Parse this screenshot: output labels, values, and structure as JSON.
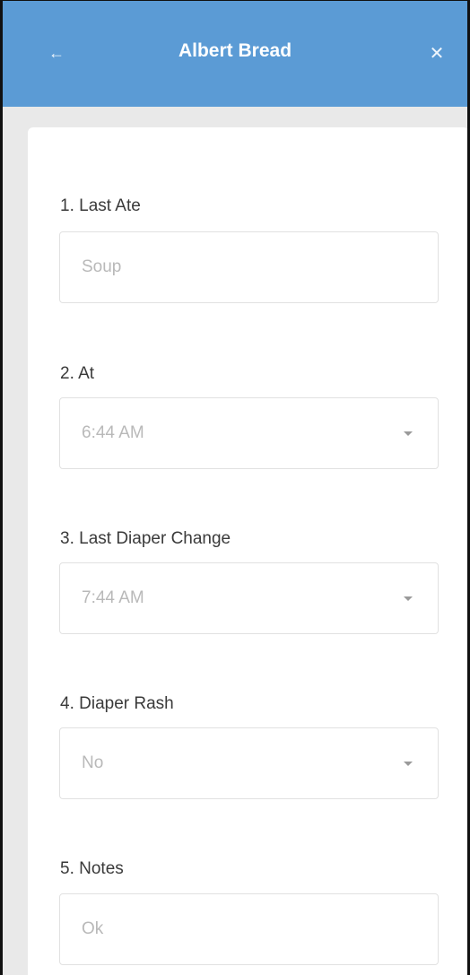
{
  "header": {
    "back_icon": "arrow-left-icon",
    "title": "Albert Bread",
    "close_icon": "close-icon",
    "color": "#5b9bd5"
  },
  "form": {
    "fields": [
      {
        "label": "1. Last Ate",
        "value": "Soup",
        "type": "text"
      },
      {
        "label": "2. At",
        "value": "6:44 AM",
        "type": "select"
      },
      {
        "label": "3. Last Diaper Change",
        "value": "7:44 AM",
        "type": "select"
      },
      {
        "label": "4. Diaper Rash",
        "value": "No",
        "type": "select"
      },
      {
        "label": "5. Notes",
        "value": "Ok",
        "type": "text"
      }
    ]
  }
}
